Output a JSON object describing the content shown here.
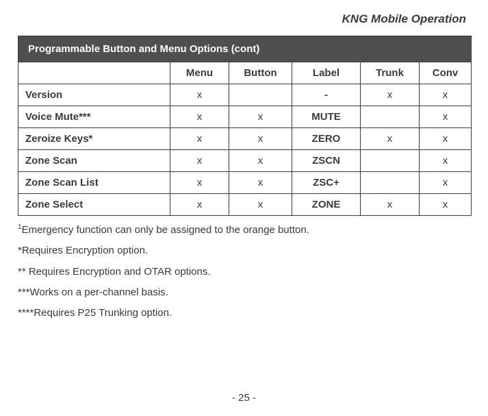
{
  "running_head": "KNG Mobile Operation",
  "table": {
    "title": "Programmable Button and Menu Options",
    "title_suffix": "(cont)",
    "columns": [
      "Menu",
      "Button",
      "Label",
      "Trunk",
      "Conv"
    ],
    "rows": [
      {
        "feature": "Version",
        "menu": "x",
        "button": "",
        "label": "-",
        "trunk": "x",
        "conv": "x"
      },
      {
        "feature": "Voice Mute***",
        "menu": "x",
        "button": "x",
        "label": "MUTE",
        "trunk": "",
        "conv": "x"
      },
      {
        "feature": "Zeroize Keys*",
        "menu": "x",
        "button": "x",
        "label": "ZERO",
        "trunk": "x",
        "conv": "x"
      },
      {
        "feature": "Zone Scan",
        "menu": "x",
        "button": "x",
        "label": "ZSCN",
        "trunk": "",
        "conv": "x"
      },
      {
        "feature": "Zone Scan List",
        "menu": "x",
        "button": "x",
        "label": "ZSC+",
        "trunk": "",
        "conv": "x"
      },
      {
        "feature": "Zone Select",
        "menu": "x",
        "button": "x",
        "label": "ZONE",
        "trunk": "x",
        "conv": "x"
      }
    ]
  },
  "notes": {
    "n1_sup": "1",
    "n1": "Emergency function can only be assigned to the orange button.",
    "n2": "*Requires Encryption option.",
    "n3": "** Requires Encryption and OTAR options.",
    "n4": "***Works on a per-channel basis.",
    "n5": "****Requires P25 Trunking option."
  },
  "page_number": "- 25 -"
}
